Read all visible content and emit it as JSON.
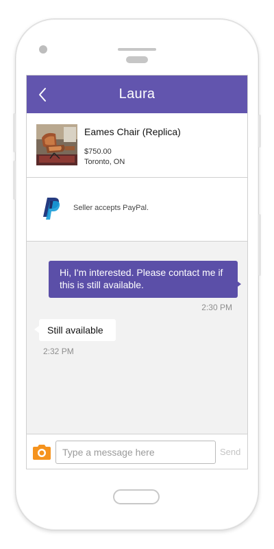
{
  "header": {
    "title": "Laura",
    "back_icon": "chevron-left-icon",
    "color": "#6255ae"
  },
  "listing": {
    "title": "Eames Chair (Replica)",
    "price": "$750.00",
    "location": "Toronto, ON",
    "image": "chair-photo"
  },
  "payment": {
    "icon": "paypal-icon",
    "text": "Seller accepts PayPal."
  },
  "messages": [
    {
      "direction": "outgoing",
      "text": "Hi, I'm interested. Please contact me if this is still available.",
      "time": "2:30 PM"
    },
    {
      "direction": "incoming",
      "text": "Still available",
      "time": "2:32 PM"
    }
  ],
  "composer": {
    "camera_icon": "camera-icon",
    "placeholder": "Type a message here",
    "value": "",
    "send_label": "Send",
    "accent": "#f5931e"
  }
}
